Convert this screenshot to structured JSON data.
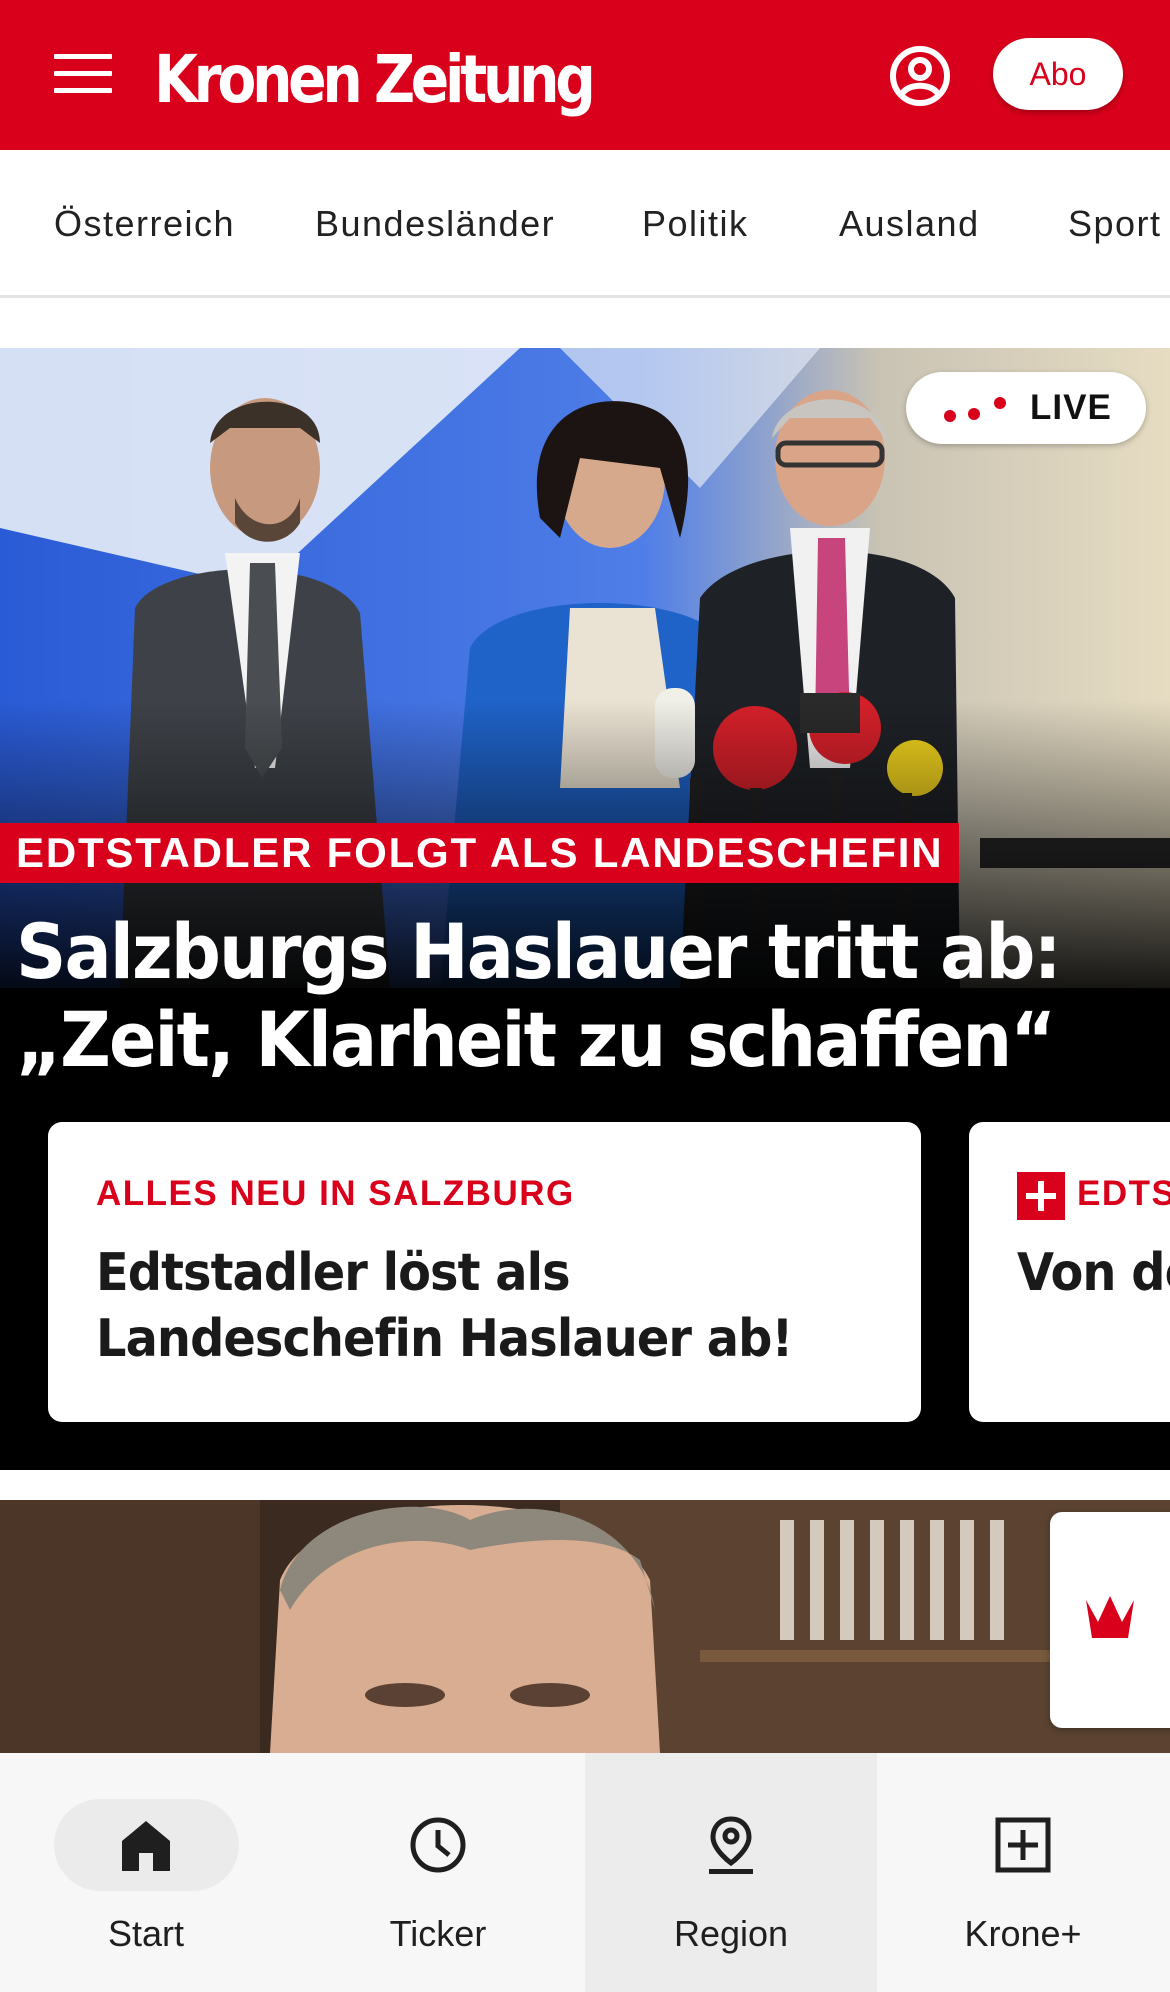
{
  "header": {
    "logo_text": "Kronen Zeitung",
    "abo_label": "Abo",
    "brand_color": "#d9001b"
  },
  "nav": {
    "categories": [
      "Österreich",
      "Bundesländer",
      "Politik",
      "Ausland",
      "Sport"
    ]
  },
  "hero": {
    "live_label": "LIVE",
    "kicker": "EDTSTADLER FOLGT ALS LANDESCHEFIN",
    "headline": "Salzburgs Haslauer tritt ab: „Zeit, Klarheit zu schaffen“"
  },
  "cards": [
    {
      "kicker": "ALLES NEU IN SALZBURG",
      "title": "Edtstadler löst als Landeschefin Haslauer ab!"
    },
    {
      "kicker": "EDTS",
      "title": "Von de Landes",
      "premium": true
    }
  ],
  "bottom_nav": [
    {
      "label": "Start",
      "icon": "home-icon",
      "active": true
    },
    {
      "label": "Ticker",
      "icon": "clock-icon",
      "active": false
    },
    {
      "label": "Region",
      "icon": "location-pin-icon",
      "active": false
    },
    {
      "label": "Krone+",
      "icon": "plus-square-icon",
      "active": false
    }
  ]
}
